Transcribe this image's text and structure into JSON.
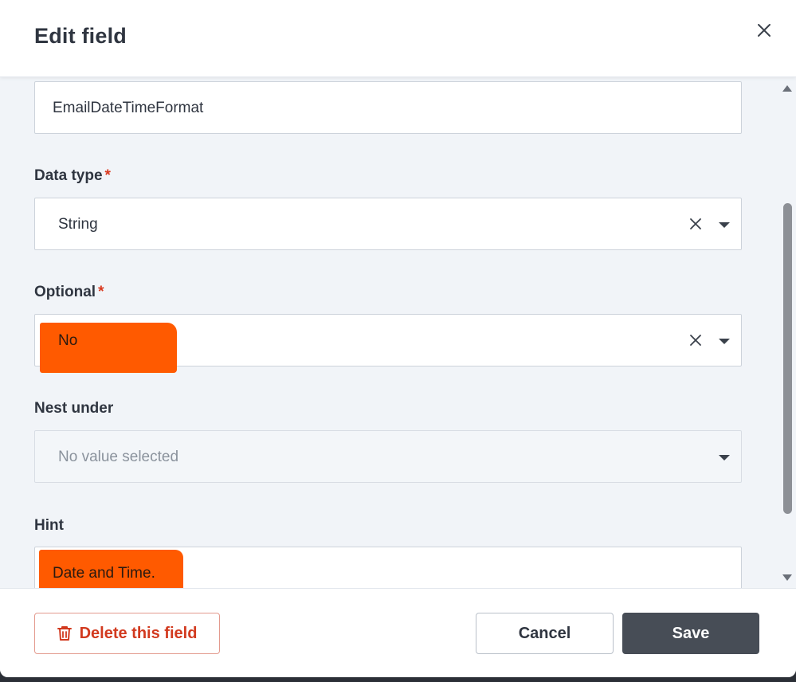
{
  "dialog": {
    "title": "Edit field"
  },
  "fields": {
    "name": {
      "value": "EmailDateTimeFormat"
    },
    "data_type": {
      "label": "Data type",
      "required_mark": "*",
      "value": "String"
    },
    "optional": {
      "label": "Optional",
      "required_mark": "*",
      "value": "No"
    },
    "nest_under": {
      "label": "Nest under",
      "placeholder": "No value selected"
    },
    "hint": {
      "label": "Hint",
      "value": "Date and Time."
    }
  },
  "footer": {
    "delete_label": "Delete this field",
    "cancel_label": "Cancel",
    "save_label": "Save"
  },
  "colors": {
    "redaction": "#ff5a00",
    "required": "#d9381e",
    "danger": "#d23a1f",
    "primary_button": "#474d56"
  },
  "icons": {
    "close": "close-icon",
    "clear": "clear-icon",
    "dropdown": "chevron-down-icon",
    "delete": "trash-icon"
  }
}
